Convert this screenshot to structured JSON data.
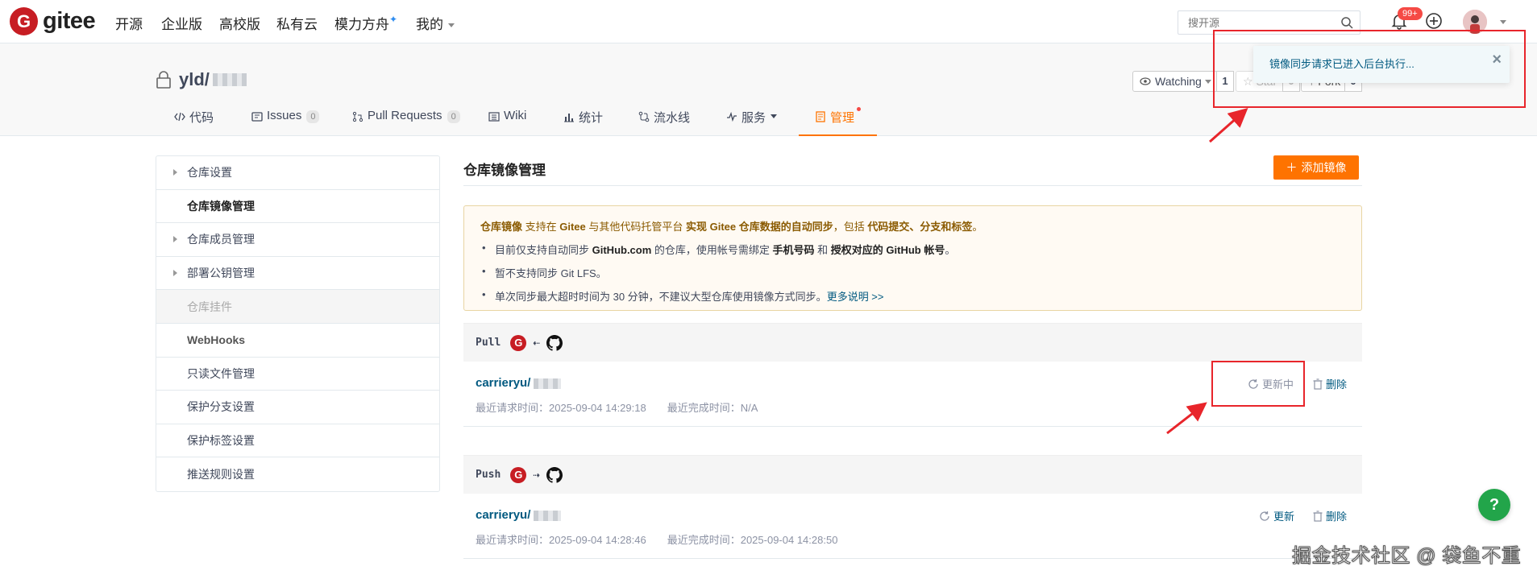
{
  "topnav": {
    "logo_letter": "G",
    "logo_text": "gitee",
    "items": [
      "开源",
      "企业版",
      "高校版",
      "私有云",
      "模力方舟",
      "我的"
    ],
    "spark": "✦",
    "search_placeholder": "搜开源",
    "notify_count": "99+"
  },
  "repo": {
    "owner": "yld/",
    "watch_label": "Watching",
    "watch_count": "1",
    "star_label": "Star",
    "star_count": "0",
    "fork_label": "Fork",
    "fork_count": "0"
  },
  "tabs": [
    {
      "label": "代码",
      "icon": "code-icon"
    },
    {
      "label": "Issues",
      "count": "0",
      "icon": "issues-icon"
    },
    {
      "label": "Pull Requests",
      "count": "0",
      "icon": "pr-icon"
    },
    {
      "label": "Wiki",
      "icon": "wiki-icon"
    },
    {
      "label": "统计",
      "icon": "chart-icon"
    },
    {
      "label": "流水线",
      "icon": "pipeline-icon"
    },
    {
      "label": "服务",
      "icon": "service-icon"
    },
    {
      "label": "管理",
      "icon": "manage-icon"
    }
  ],
  "sidebar": [
    {
      "label": "仓库设置",
      "arrow": true
    },
    {
      "label": "仓库镜像管理",
      "active": true
    },
    {
      "label": "仓库成员管理",
      "arrow": true
    },
    {
      "label": "部署公钥管理",
      "arrow": true
    },
    {
      "label": "仓库挂件",
      "disabled": true
    },
    {
      "label": "WebHooks"
    },
    {
      "label": "只读文件管理"
    },
    {
      "label": "保护分支设置"
    },
    {
      "label": "保护标签设置"
    },
    {
      "label": "推送规则设置"
    }
  ],
  "main": {
    "title": "仓库镜像管理",
    "add_button": "添加镜像",
    "notice": {
      "head_1": "仓库镜像",
      "head_2": " 支持在 ",
      "head_3": "Gitee",
      "head_4": " 与其他代码托管平台 ",
      "head_5": "实现 Gitee 仓库数据的自动同步",
      "head_6": "，包括 ",
      "head_7": "代码提交、分支和标签",
      "head_8": "。",
      "l1_a": "目前仅支持自动同步 ",
      "l1_b": "GitHub.com",
      "l1_c": " 的仓库，使用帐号需绑定 ",
      "l1_d": "手机号码",
      "l1_e": " 和 ",
      "l1_f": "授权对应的 GitHub 帐号",
      "l1_g": "。",
      "l2": "暂不支持同步 Git LFS。",
      "l3": "单次同步最大超时时间为 30 分钟，不建议大型仓库使用镜像方式同步。",
      "l3_link": "更多说明 >>"
    },
    "pull": {
      "label": "Pull",
      "arrow": "⇠",
      "repo": "carrieryu/",
      "request_time": "最近请求时间：2025-09-04 14:29:18",
      "finish_time": "最近完成时间：N/A",
      "status": "更新中",
      "delete": "删除"
    },
    "push": {
      "label": "Push",
      "arrow": "⇢",
      "repo": "carrieryu/",
      "request_time": "最近请求时间：2025-09-04 14:28:46",
      "finish_time": "最近完成时间：2025-09-04 14:28:50",
      "update": "更新",
      "delete": "删除"
    }
  },
  "toast": {
    "message": "镜像同步请求已进入后台执行...",
    "close": "×"
  },
  "help": "?",
  "watermark": "掘金技术社区 @ 袋鱼不重"
}
